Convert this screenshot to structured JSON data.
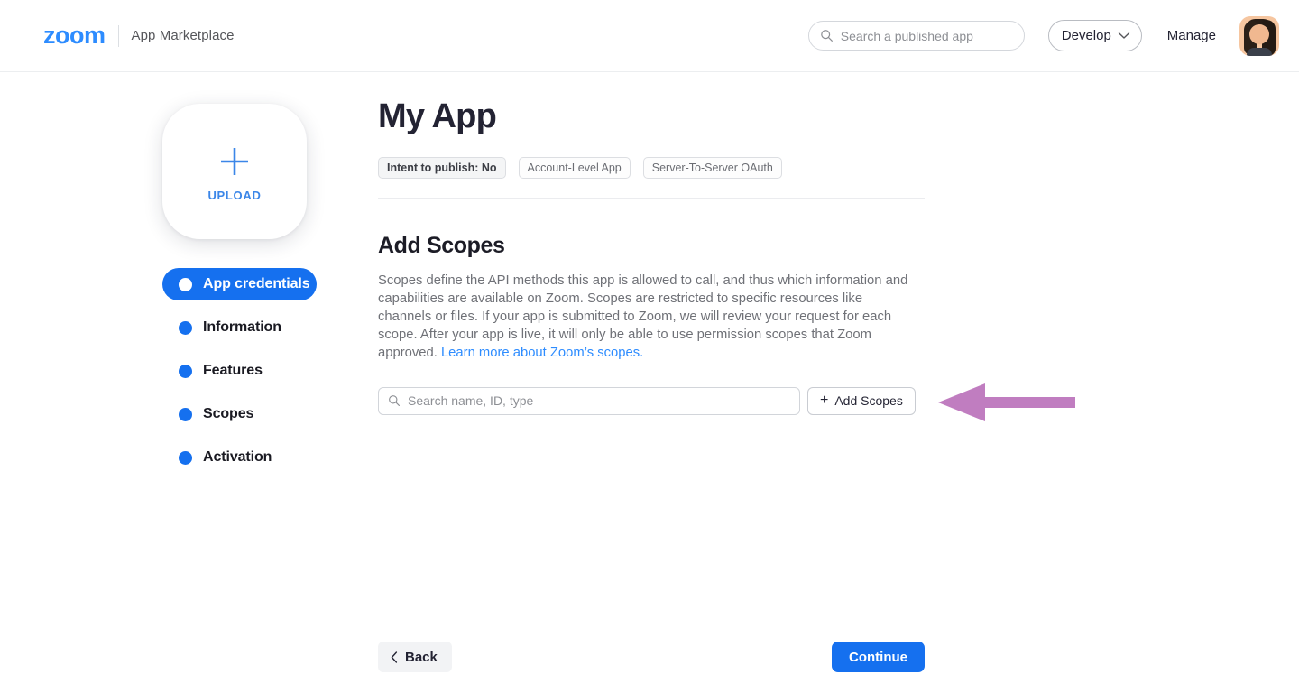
{
  "header": {
    "logo_text": "zoom",
    "brand_sub": "App Marketplace",
    "search": {
      "placeholder": "Search a published app",
      "value": "",
      "icon": "search-icon"
    },
    "develop_dropdown": {
      "label": "Develop",
      "icon": "chevron-down-icon"
    },
    "manage_label": "Manage",
    "avatar": "user-avatar"
  },
  "sidebar": {
    "upload": {
      "icon": "plus-icon",
      "label": "UPLOAD"
    },
    "items": [
      {
        "label": "App credentials",
        "active": true
      },
      {
        "label": "Information",
        "active": false
      },
      {
        "label": "Features",
        "active": false
      },
      {
        "label": "Scopes",
        "active": false
      },
      {
        "label": "Activation",
        "active": false
      }
    ]
  },
  "main": {
    "title": "My App",
    "chips": [
      "Intent to publish: No",
      "Account-Level App",
      "Server-To-Server OAuth"
    ],
    "section": {
      "title": "Add Scopes",
      "description": "Scopes define the API methods this app is allowed to call, and thus which information and capabilities are available on Zoom. Scopes are restricted to specific resources like channels or files. If your app is submitted to Zoom, we will review your request for each scope. After your app is live, it will only be able to use permission scopes that Zoom approved.",
      "link_text": "Learn more about Zoom’s scopes."
    },
    "scope_search": {
      "placeholder": "Search name, ID, type",
      "value": "",
      "icon": "search-icon"
    },
    "add_scopes_button": {
      "label": "Add Scopes",
      "icon": "plus-icon"
    }
  },
  "annotation": {
    "type": "arrow-left",
    "color": "#C07DC0",
    "points_to": "add-scopes-button"
  },
  "footer": {
    "back_label": "Back",
    "back_icon": "chevron-left-icon",
    "continue_label": "Continue"
  },
  "colors": {
    "brand_blue": "#2D8CFF",
    "accent_blue": "#1570EF",
    "annotation_purple": "#C07DC0",
    "text_primary": "#232333",
    "text_muted": "#6F7177"
  }
}
